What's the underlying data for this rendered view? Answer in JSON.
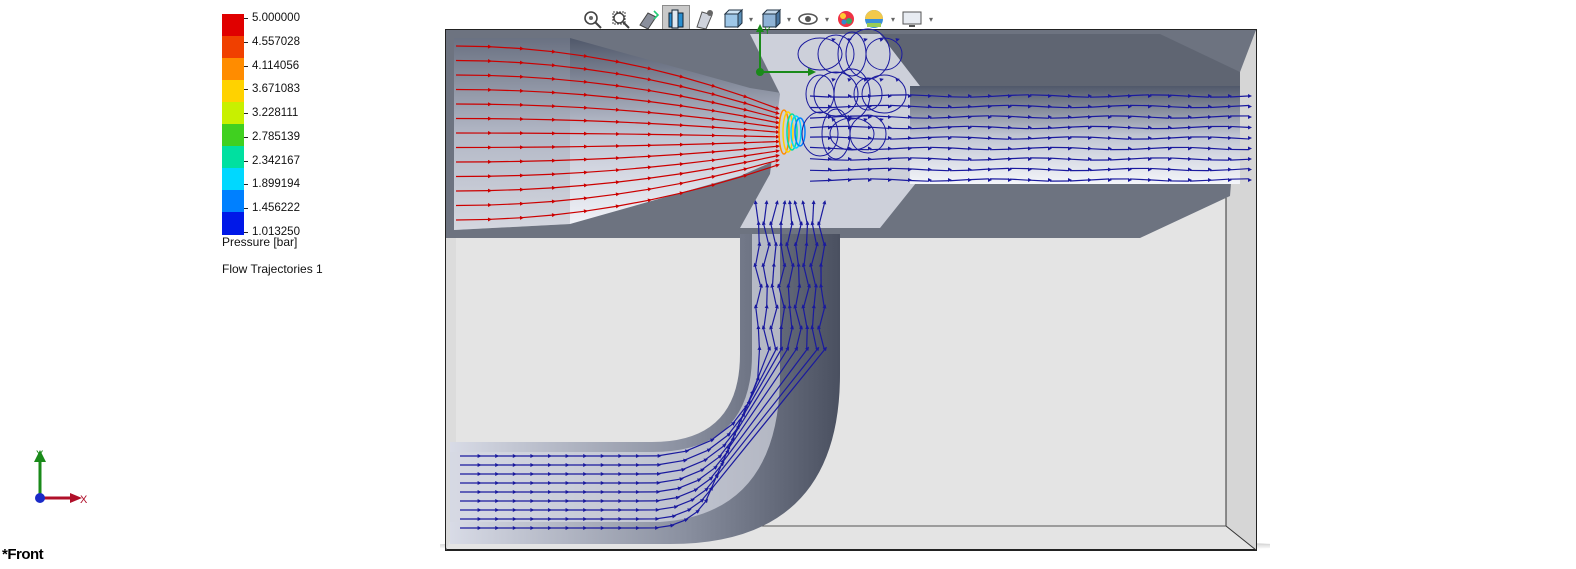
{
  "toolbar": {
    "items": [
      {
        "name": "zoom-to-fit-icon",
        "dropdown": false
      },
      {
        "name": "zoom-to-area-icon",
        "dropdown": false
      },
      {
        "name": "previous-view-icon",
        "dropdown": false
      },
      {
        "name": "section-view-icon",
        "dropdown": false,
        "active": true
      },
      {
        "name": "dynamic-annotation-icon",
        "dropdown": false
      },
      {
        "name": "view-orientation-icon",
        "dropdown": true
      },
      {
        "name": "display-style-icon",
        "dropdown": true
      },
      {
        "name": "hide-show-items-icon",
        "dropdown": true
      },
      {
        "name": "edit-appearance-icon",
        "dropdown": false
      },
      {
        "name": "apply-scene-icon",
        "dropdown": true
      },
      {
        "name": "view-settings-icon",
        "dropdown": true
      }
    ]
  },
  "legend": {
    "values": [
      "5.000000",
      "4.557028",
      "4.114056",
      "3.671083",
      "3.228111",
      "2.785139",
      "2.342167",
      "1.899194",
      "1.456222",
      "1.013250"
    ],
    "colors": [
      "#e00000",
      "#f04000",
      "#ff8c00",
      "#ffd200",
      "#c8f000",
      "#40d020",
      "#00e0a0",
      "#00d8ff",
      "#0080ff",
      "#0018e8"
    ],
    "unit_label": "Pressure [bar]",
    "plot_name": "Flow Trajectories 1"
  },
  "triad": {
    "x_label": "X",
    "y_label": "Y"
  },
  "view": {
    "label": "*Front",
    "triad_y_label": "Y"
  },
  "colors": {
    "high_pressure": "#cc0000",
    "low_pressure": "#1a1a9e",
    "model_face": "#6e7481",
    "model_light": "#dde0ea"
  }
}
